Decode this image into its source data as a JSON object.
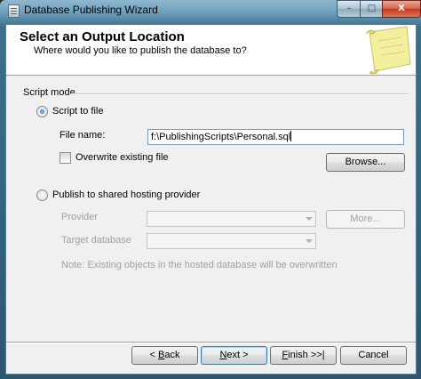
{
  "window": {
    "title": "Database Publishing Wizard",
    "minimize_glyph": "–",
    "maximize_glyph": "□",
    "close_glyph": "X"
  },
  "header": {
    "title": "Select an Output Location",
    "subtitle": "Where would you like to publish the database to?",
    "illustration_icon": "scroll-icon"
  },
  "script_mode": {
    "group_label": "Script mode",
    "script_to_file": {
      "label": "Script to file",
      "selected": true,
      "file_name_label": "File name:",
      "file_name_value": "f:\\PublishingScripts\\Personal.sql",
      "overwrite_label": "Overwrite existing file",
      "overwrite_checked": false,
      "browse_label": "Browse..."
    },
    "hosting": {
      "label": "Publish to shared hosting provider",
      "selected": false,
      "provider_label": "Provider",
      "more_label": "More...",
      "target_db_label": "Target database",
      "note": "Note: Existing objects in the hosted database will be overwritten"
    }
  },
  "footer": {
    "back_pre": "< ",
    "back_key": "B",
    "back_post": "ack",
    "next_key": "N",
    "next_post": "ext >",
    "finish_key": "F",
    "finish_post": "inish >>|",
    "cancel_label": "Cancel"
  },
  "colors": {
    "titlebar": "#6e9fbc",
    "accent_default_button": "#3c7fb1",
    "close_button": "#c23b22",
    "disabled_text": "#a0a0a0"
  }
}
